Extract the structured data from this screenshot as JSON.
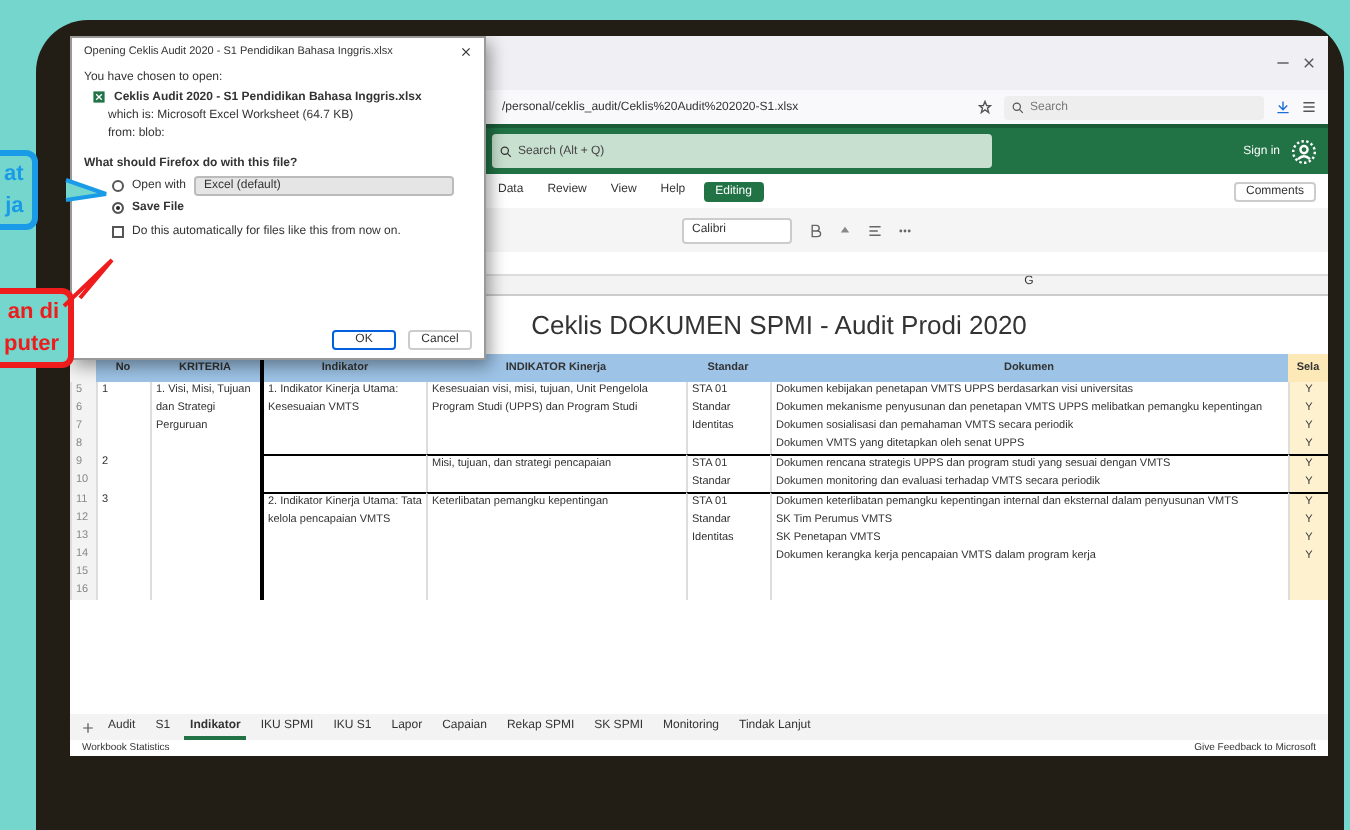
{
  "callouts": [
    {
      "kind": "info",
      "lines": [
        "at",
        "ja"
      ]
    },
    {
      "kind": "warning",
      "lines": [
        "an di",
        "puter"
      ]
    }
  ],
  "browser": {
    "url": "/personal/ceklis_audit/Ceklis%20Audit%202020-S1.xlsx",
    "search": {
      "placeholder": "Search"
    }
  },
  "app_header": {
    "search": {
      "placeholder": "Search (Alt + Q)"
    },
    "sign_in": "Sign in"
  },
  "ribbon": {
    "tabs": [
      {
        "label": "Data",
        "selected": false
      },
      {
        "label": "Review",
        "selected": false
      },
      {
        "label": "View",
        "selected": false
      },
      {
        "label": "Help",
        "selected": false
      }
    ],
    "mode_button": "Editing",
    "comments_button": "Comments",
    "font": "Calibri"
  },
  "sheet": {
    "column_letter": "G",
    "title": "Ceklis DOKUMEN SPMI - Audit Prodi 2020",
    "columns": [
      "No",
      "KRITERIA",
      "Indikator",
      "INDIKATOR Kinerja",
      "Standar",
      "Dokumen",
      "Sela"
    ],
    "rows": [
      {
        "row_numbers": [
          "5",
          "6",
          "7",
          "8"
        ],
        "no": "1",
        "kriteria": "1. Visi, Misi, Tujuan dan Strategi Perguruan",
        "indikator": "1. Indikator Kinerja Utama: Kesesuaian VMTS",
        "kinerja": "Kesesuaian visi, misi, tujuan, Unit Pengelola Program Studi (UPPS) dan Program Studi",
        "standar": "STA 01 Standar Identitas",
        "docs": [
          {
            "text": "Dokumen kebijakan penetapan VMTS UPPS berdasarkan visi universitas",
            "mark": "Y"
          },
          {
            "text": "Dokumen mekanisme penyusunan dan penetapan VMTS UPPS melibatkan pemangku kepentingan",
            "mark": "Y"
          },
          {
            "text": "Dokumen sosialisasi dan pemahaman VMTS secara periodik",
            "mark": "Y"
          },
          {
            "text": "Dokumen VMTS yang ditetapkan oleh senat UPPS",
            "mark": "Y"
          }
        ]
      },
      {
        "row_numbers": [
          "9",
          "10"
        ],
        "no": "2",
        "kinerja": "Misi, tujuan, dan strategi pencapaian",
        "standar": "STA 01 Standar",
        "docs": [
          {
            "text": "Dokumen rencana strategis UPPS dan program studi yang sesuai dengan VMTS",
            "mark": "Y"
          },
          {
            "text": "Dokumen monitoring dan evaluasi terhadap VMTS secara periodik",
            "mark": "Y"
          }
        ]
      },
      {
        "row_numbers": [
          "11",
          "12",
          "13",
          "14",
          "15",
          "16"
        ],
        "no": "3",
        "indikator": "2. Indikator Kinerja Utama: Tata kelola pencapaian VMTS",
        "kinerja": "Keterlibatan pemangku kepentingan",
        "standar": "STA 01 Standar Identitas",
        "docs": [
          {
            "text": "Dokumen keterlibatan pemangku kepentingan internal dan eksternal dalam penyusunan VMTS",
            "mark": "Y"
          },
          {
            "text": "SK Tim Perumus VMTS",
            "mark": "Y"
          },
          {
            "text": "SK Penetapan VMTS",
            "mark": "Y"
          },
          {
            "text": "Dokumen kerangka kerja pencapaian VMTS dalam program kerja",
            "mark": "Y"
          }
        ]
      }
    ]
  },
  "sheet_tabs": [
    {
      "label": "Audit",
      "selected": false
    },
    {
      "label": "S1",
      "selected": false
    },
    {
      "label": "Indikator",
      "selected": true
    },
    {
      "label": "IKU SPMI",
      "selected": false
    },
    {
      "label": "IKU S1",
      "selected": false
    },
    {
      "label": "Lapor",
      "selected": false
    },
    {
      "label": "Capaian",
      "selected": false
    },
    {
      "label": "Rekap SPMI",
      "selected": false
    },
    {
      "label": "SK SPMI",
      "selected": false
    },
    {
      "label": "Monitoring",
      "selected": false
    },
    {
      "label": "Tindak Lanjut",
      "selected": false
    }
  ],
  "status_bar": {
    "left": "Workbook Statistics",
    "right": "Give Feedback to Microsoft"
  },
  "dialog": {
    "title": "Opening Ceklis Audit 2020 - S1 Pendidikan Bahasa Inggris.xlsx",
    "intro": "You have chosen to open:",
    "file": "Ceklis Audit 2020 - S1 Pendidikan Bahasa Inggris.xlsx",
    "type": "which is: Microsoft Excel Worksheet (64.7 KB)",
    "from": "from: blob:",
    "question": "What should Firefox do with this file?",
    "options": [
      {
        "label": "Open with",
        "selected": false,
        "app": "Excel (default)"
      },
      {
        "label": "Save File",
        "selected": true
      }
    ],
    "auto": {
      "label": "Do this automatically for files like this from now on.",
      "checked": false
    },
    "ok": "OK",
    "cancel": "Cancel"
  }
}
